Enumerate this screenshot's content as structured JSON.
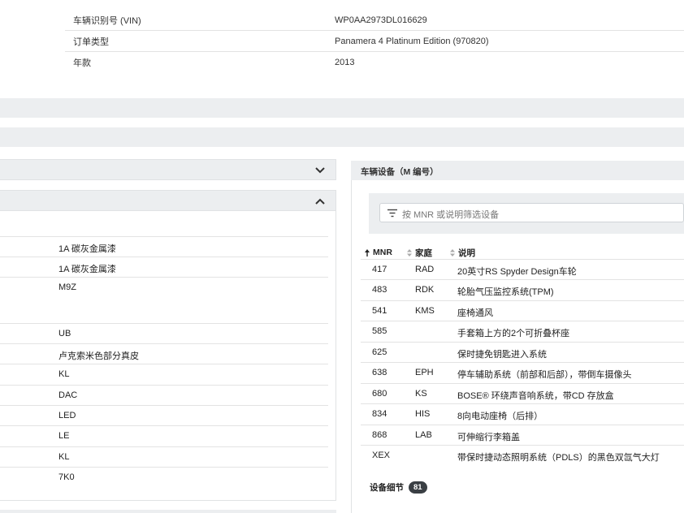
{
  "vehicle_info": {
    "rows": [
      {
        "label": "车辆识别号 (VIN)",
        "value": "WP0AA2973DL016629"
      },
      {
        "label": "订单类型",
        "value": "Panamera 4 Platinum Edition (970820)"
      },
      {
        "label": "年款",
        "value": "2013"
      }
    ]
  },
  "left_panel": {
    "rows": [
      "1A 碳灰金属漆",
      "1A 碳灰金属漆",
      "M9Z",
      "UB",
      "卢克索米色部分真皮",
      "KL",
      "DAC",
      "LED",
      "LE",
      "KL",
      "7K0"
    ]
  },
  "equipment": {
    "title": "车辆设备（M 编号）",
    "filter_placeholder": "按 MNR 或说明筛选设备",
    "columns": {
      "mnr": "MNR",
      "family": "家庭",
      "description": "说明"
    },
    "rows": [
      {
        "mnr": "417",
        "family": "RAD",
        "description": "20英寸RS Spyder Design车轮"
      },
      {
        "mnr": "483",
        "family": "RDK",
        "description": "轮胎气压监控系统(TPM)"
      },
      {
        "mnr": "541",
        "family": "KMS",
        "description": "座椅通风"
      },
      {
        "mnr": "585",
        "family": "",
        "description": "手套箱上方的2个可折叠杯座"
      },
      {
        "mnr": "625",
        "family": "",
        "description": "保时捷免钥匙进入系统"
      },
      {
        "mnr": "638",
        "family": "EPH",
        "description": "停车辅助系统（前部和后部），带倒车摄像头"
      },
      {
        "mnr": "680",
        "family": "KS",
        "description": "BOSE® 环绕声音响系统，带CD 存放盒"
      },
      {
        "mnr": "834",
        "family": "HIS",
        "description": "8向电动座椅（后排）"
      },
      {
        "mnr": "868",
        "family": "LAB",
        "description": "可伸缩行李箱盖"
      },
      {
        "mnr": "XEX",
        "family": "",
        "description": "带保时捷动态照明系统（PDLS）的黑色双氙气大灯"
      }
    ],
    "detail_label": "设备细节",
    "detail_count": "81"
  },
  "icons": {
    "accordion_1": "chevron-down-icon",
    "accordion_2": "chevron-up-icon",
    "filter": "filter-icon",
    "sort": "sort-icon"
  }
}
